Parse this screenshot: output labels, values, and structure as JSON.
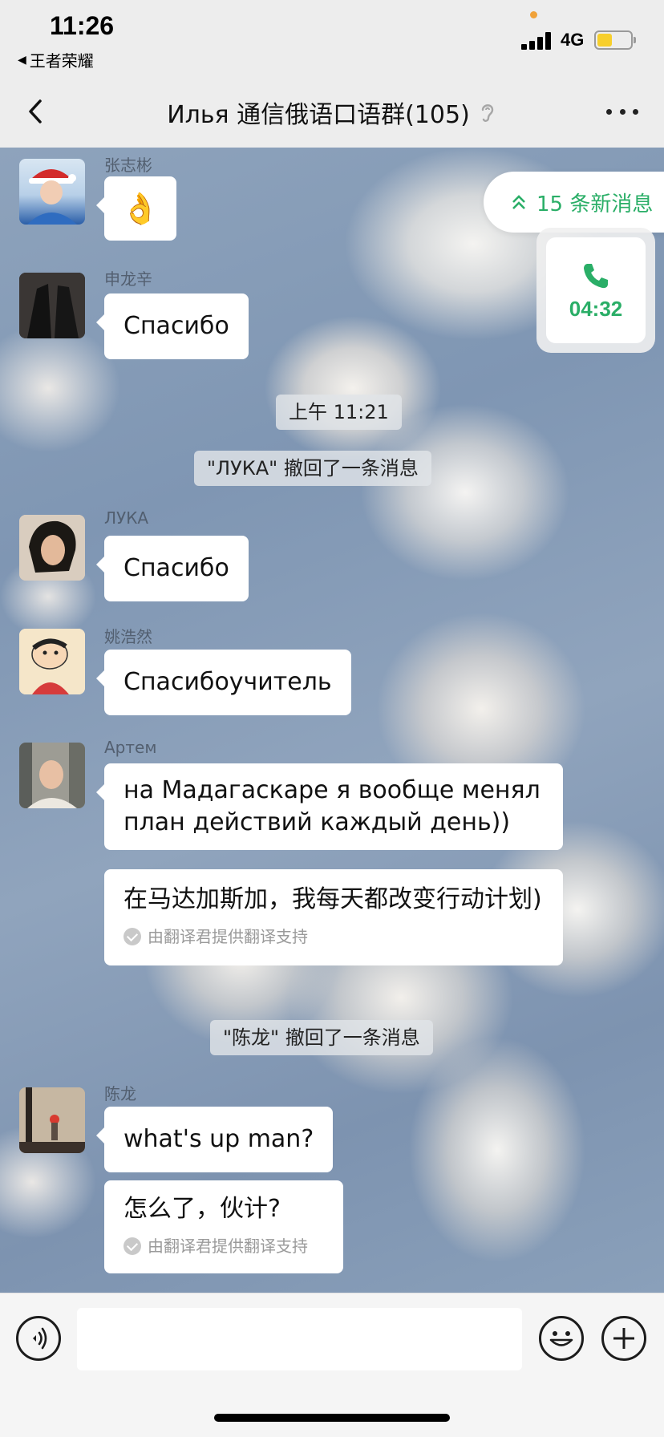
{
  "status_bar": {
    "time": "11:26",
    "back_app": "王者荣耀",
    "network": "4G",
    "battery_level": 0.45,
    "battery_color": "#f7cf2c"
  },
  "nav": {
    "title": "Илья 通信俄语口语群(105)",
    "back_icon": "chevron-left-icon",
    "mute_icon": "ear-icon",
    "more_icon": "more-dots-icon"
  },
  "new_messages": {
    "label": "15 条新消息",
    "icon": "double-chevron-up-icon"
  },
  "call": {
    "duration": "04:32",
    "icon": "phone-icon",
    "color": "#2aae67"
  },
  "messages": [
    {
      "sender": "张志彬",
      "text": "👌"
    },
    {
      "sender": "申龙辛",
      "text": "Спасибо"
    },
    {
      "sender": "ЛУКА",
      "text": "Спасибо"
    },
    {
      "sender": "姚浩然",
      "text": "Спасибоучитель"
    },
    {
      "sender": "Артем",
      "text": "на Мадагаскаре я вообще менял план действий каждый день))",
      "translation": "在马达加斯加，我每天都改变行动计划)",
      "translation_note": "由翻译君提供翻译支持"
    },
    {
      "sender": "陈龙",
      "text": "what's up man?",
      "translation": "怎么了，伙计?",
      "translation_note": "由翻译君提供翻译支持"
    }
  ],
  "system": {
    "timestamp": "上午 11:21",
    "recall_luka": "\"ЛУКА\" 撤回了一条消息",
    "recall_chenlong": "\"陈龙\" 撤回了一条消息"
  },
  "input": {
    "value": "",
    "placeholder": ""
  }
}
